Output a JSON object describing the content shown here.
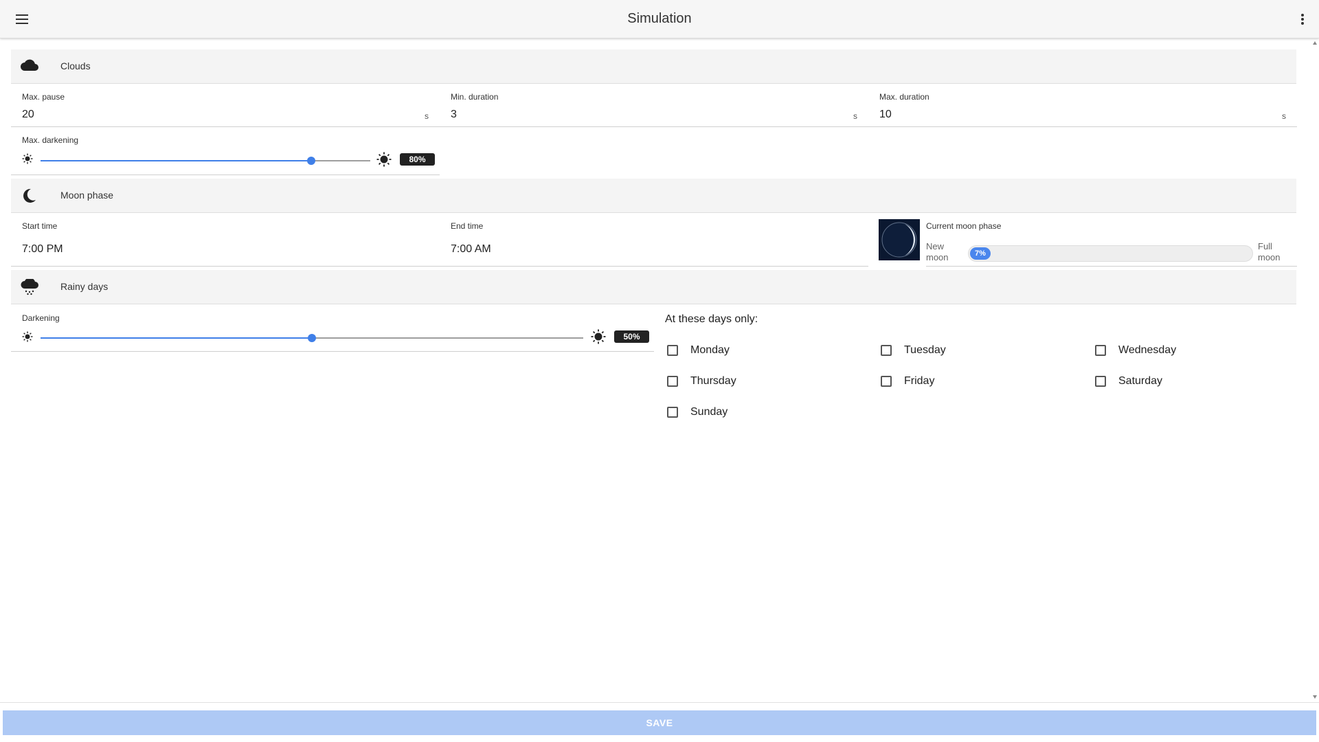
{
  "app": {
    "title": "Simulation",
    "menu_icon": "hamburger-menu-icon",
    "more_icon": "more-vert-icon"
  },
  "clouds": {
    "section_title": "Clouds",
    "icon": "cloud-icon",
    "max_pause": {
      "label": "Max. pause",
      "value": "20",
      "unit": "s"
    },
    "min_duration": {
      "label": "Min. duration",
      "value": "3",
      "unit": "s"
    },
    "max_duration": {
      "label": "Max. duration",
      "value": "10",
      "unit": "s"
    },
    "max_darkening": {
      "label": "Max. darkening",
      "value_label": "80%",
      "fraction": 0.82
    }
  },
  "moon": {
    "section_title": "Moon phase",
    "icon": "crescent-moon-icon",
    "start_time": {
      "label": "Start time",
      "value": "7:00 PM"
    },
    "end_time": {
      "label": "End time",
      "value": "7:00 AM"
    },
    "current_phase": {
      "label": "Current moon phase",
      "left_label_1": "New",
      "left_label_2": "moon",
      "right_label_1": "Full",
      "right_label_2": "moon",
      "value_label": "7%",
      "fraction": 0.07
    }
  },
  "rainy": {
    "section_title": "Rainy days",
    "icon": "rain-cloud-icon",
    "darkening": {
      "label": "Darkening",
      "value_label": "50%",
      "fraction": 0.5
    },
    "days_label": "At these days only:",
    "days": [
      {
        "label": "Monday",
        "checked": false
      },
      {
        "label": "Tuesday",
        "checked": false
      },
      {
        "label": "Wednesday",
        "checked": false
      },
      {
        "label": "Thursday",
        "checked": false
      },
      {
        "label": "Friday",
        "checked": false
      },
      {
        "label": "Saturday",
        "checked": false
      },
      {
        "label": "Sunday",
        "checked": false
      }
    ]
  },
  "footer": {
    "save_label": "SAVE"
  },
  "colors": {
    "accent": "#3f7fe8",
    "save_disabled": "#aec9f5",
    "section_bg": "#f4f4f4"
  }
}
